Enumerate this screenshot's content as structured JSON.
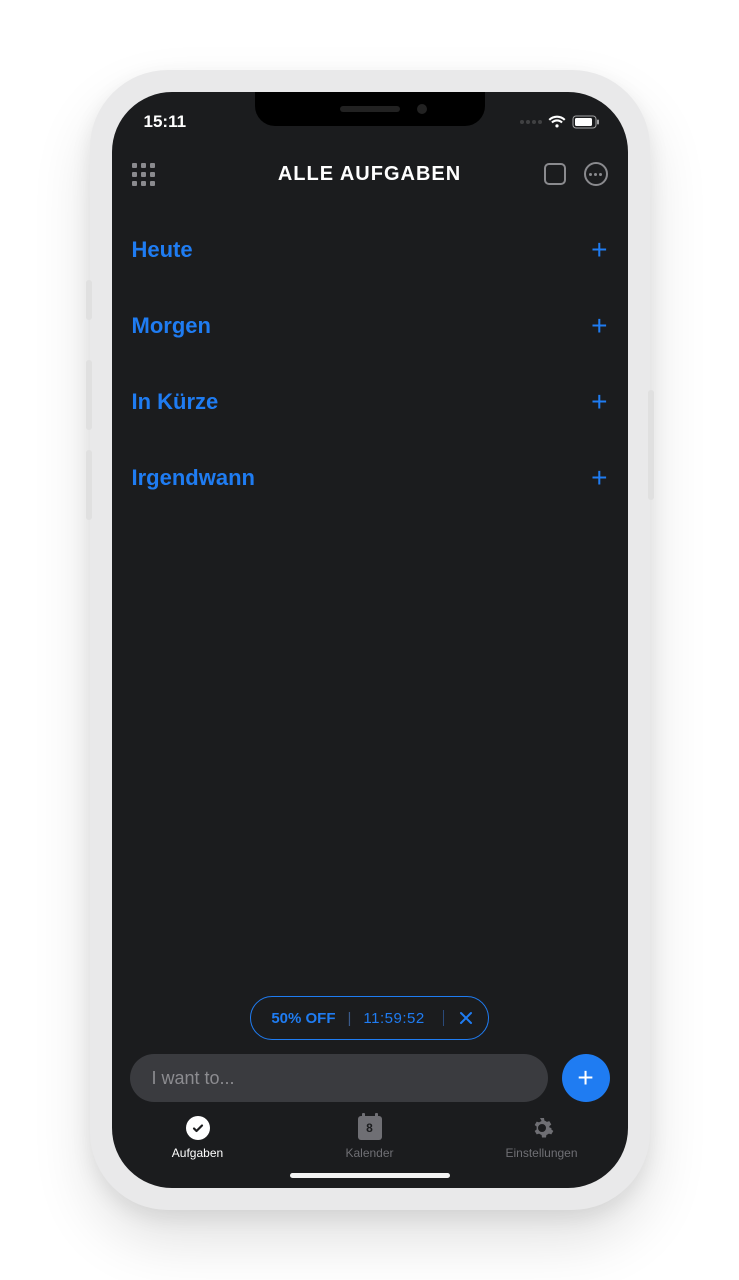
{
  "status": {
    "time": "15:11"
  },
  "nav": {
    "title": "ALLE AUFGABEN"
  },
  "sections": [
    {
      "label": "Heute"
    },
    {
      "label": "Morgen"
    },
    {
      "label": "In Kürze"
    },
    {
      "label": "Irgendwann"
    }
  ],
  "promo": {
    "offer": "50% OFF",
    "separator": "|",
    "timer": "11:59:52"
  },
  "input": {
    "placeholder": "I want to..."
  },
  "tabs": {
    "tasks": "Aufgaben",
    "calendar": "Kalender",
    "calendar_day": "8",
    "settings": "Einstellungen"
  },
  "colors": {
    "accent": "#1f7cf2",
    "bg": "#1b1c1e",
    "muted": "#8a8a8e"
  }
}
